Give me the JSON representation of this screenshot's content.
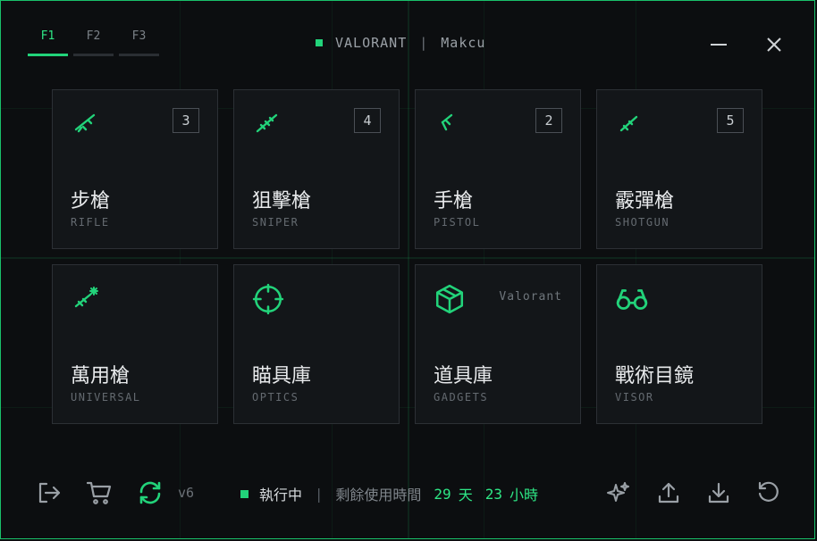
{
  "tabs": [
    "F1",
    "F2",
    "F3"
  ],
  "active_tab": 0,
  "header": {
    "game": "VALORANT",
    "separator": "|",
    "device": "Makcu"
  },
  "cards": [
    {
      "name": "步槍",
      "sub": "RIFLE",
      "badge": "3",
      "icon": "rifle-icon"
    },
    {
      "name": "狙擊槍",
      "sub": "SNIPER",
      "badge": "4",
      "icon": "sniper-icon"
    },
    {
      "name": "手槍",
      "sub": "PISTOL",
      "badge": "2",
      "icon": "pistol-icon"
    },
    {
      "name": "霰彈槍",
      "sub": "SHOTGUN",
      "badge": "5",
      "icon": "shotgun-icon"
    },
    {
      "name": "萬用槍",
      "sub": "UNIVERSAL",
      "icon": "universal-gun-icon"
    },
    {
      "name": "瞄具庫",
      "sub": "OPTICS",
      "icon": "crosshair-icon"
    },
    {
      "name": "道具庫",
      "sub": "GADGETS",
      "tag": "Valorant",
      "icon": "package-icon"
    },
    {
      "name": "戰術目鏡",
      "sub": "VISOR",
      "icon": "glasses-icon"
    }
  ],
  "footer": {
    "version": "v6",
    "status_running": "執行中",
    "separator": "|",
    "remaining_label": "剩餘使用時間",
    "days_value": "29",
    "days_unit": "天",
    "hours_value": "23",
    "hours_unit": "小時"
  },
  "colors": {
    "accent": "#22d37a",
    "background": "#0c0e10",
    "card": "#131619"
  }
}
